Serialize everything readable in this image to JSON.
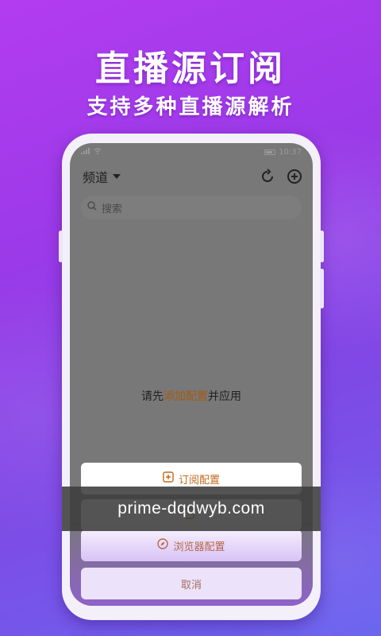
{
  "headline": "直播源订阅",
  "subheadline": "支持多种直播源解析",
  "status": {
    "time": "10:37"
  },
  "topbar": {
    "channel_label": "频道"
  },
  "search": {
    "placeholder": "搜索"
  },
  "empty_state": {
    "prefix": "请先",
    "link": "添加配置",
    "suffix": "并应用"
  },
  "sheet": {
    "subscribe_label": "订阅配置",
    "hidden_label": "",
    "browser_label": "浏览器配置",
    "cancel_label": "取消"
  },
  "watermark": "prime-dqdwyb.com",
  "colors": {
    "accent": "#c26a1b",
    "bg_top": "#b33cf0",
    "bg_bottom": "#6a64ef"
  }
}
